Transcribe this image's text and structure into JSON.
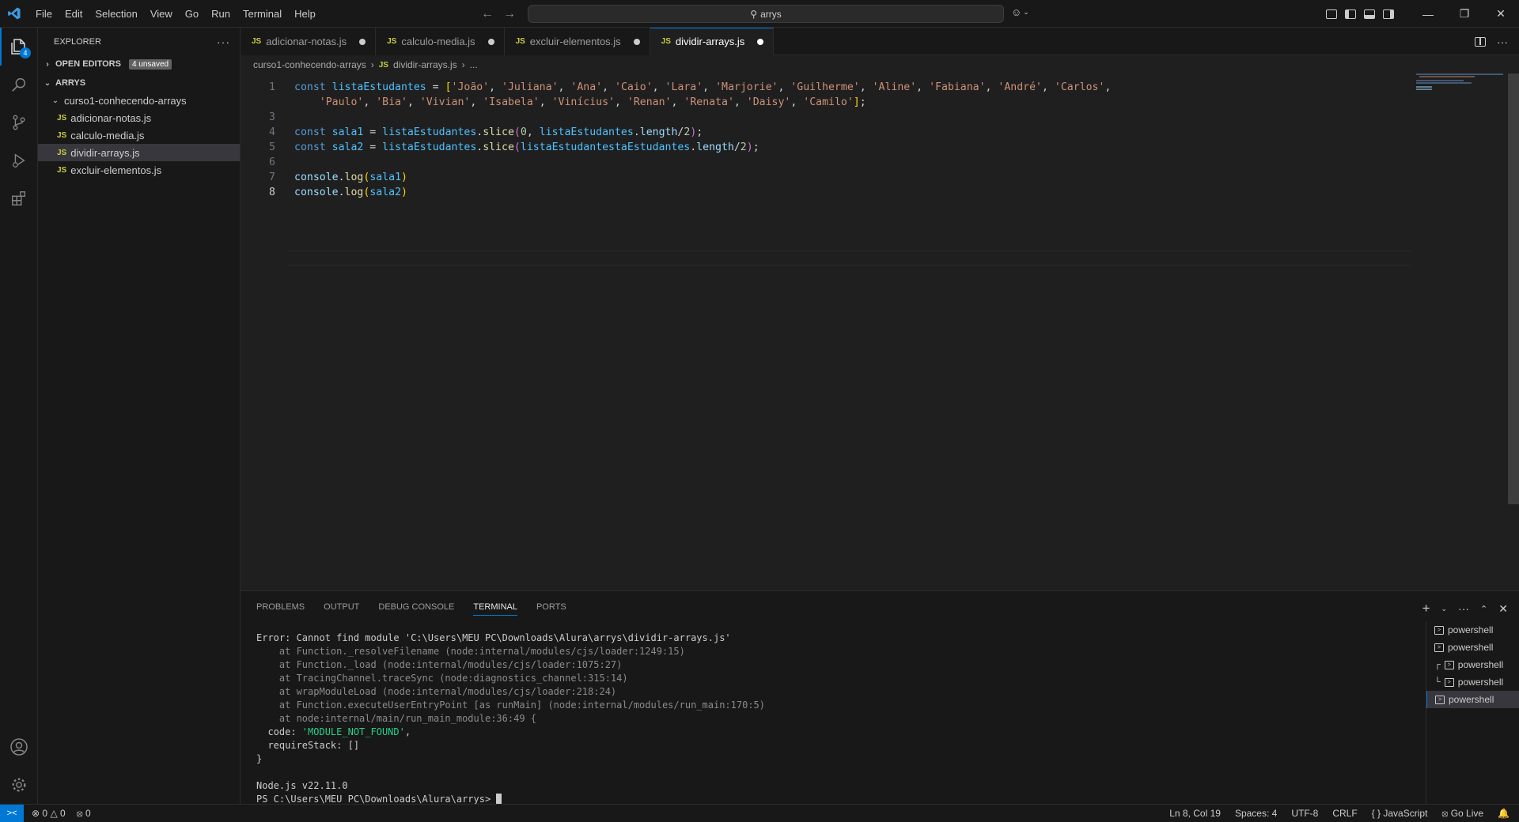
{
  "menu": [
    "File",
    "Edit",
    "Selection",
    "View",
    "Go",
    "Run",
    "Terminal",
    "Help"
  ],
  "search": {
    "text": "arrys"
  },
  "sidebar": {
    "title": "EXPLORER",
    "open_editors_label": "OPEN EDITORS",
    "unsaved_badge": "4 unsaved",
    "root_label": "ARRYS",
    "folder": "curso1-conhecendo-arrays",
    "files": [
      {
        "name": "adicionar-notas.js",
        "selected": false
      },
      {
        "name": "calculo-media.js",
        "selected": false
      },
      {
        "name": "dividir-arrays.js",
        "selected": true
      },
      {
        "name": "excluir-elementos.js",
        "selected": false
      }
    ]
  },
  "activity_badge": "4",
  "tabs": [
    {
      "label": "adicionar-notas.js",
      "active": false
    },
    {
      "label": "calculo-media.js",
      "active": false
    },
    {
      "label": "excluir-elementos.js",
      "active": false
    },
    {
      "label": "dividir-arrays.js",
      "active": true
    }
  ],
  "breadcrumb": {
    "folder": "curso1-conhecendo-arrays",
    "file": "dividir-arrays.js",
    "more": "..."
  },
  "editor": {
    "line_numbers": [
      "1",
      "",
      "3",
      "4",
      "5",
      "6",
      "7",
      "8"
    ],
    "names": [
      "João",
      "Juliana",
      "Ana",
      "Caio",
      "Lara",
      "Marjorie",
      "Guilherme",
      "Aline",
      "Fabiana",
      "André",
      "Carlos",
      "Paulo",
      "Bia",
      "Vivian",
      "Isabela",
      "Vinícius",
      "Renan",
      "Renata",
      "Daisy",
      "Camilo"
    ],
    "ident_lista": "listaEstudantes",
    "ident_sala1": "sala1",
    "ident_sala2": "sala2",
    "ident_broken": "listaEstudantestaEstudantes",
    "kw_const": "const",
    "fn_slice": "slice",
    "prop_length": "length",
    "num_0": "0",
    "num_2": "2",
    "console": "console",
    "fn_log": "log"
  },
  "panel": {
    "tabs": [
      "PROBLEMS",
      "OUTPUT",
      "DEBUG CONSOLE",
      "TERMINAL",
      "PORTS"
    ],
    "active_tab": "TERMINAL",
    "terminal_lines": [
      {
        "text": "Error: Cannot find module 'C:\\Users\\MEU PC\\Downloads\\Alura\\arrys\\dividir-arrays.js'",
        "style": ""
      },
      {
        "text": "    at Function._resolveFilename (node:internal/modules/cjs/loader:1249:15)",
        "style": "gray"
      },
      {
        "text": "    at Function._load (node:internal/modules/cjs/loader:1075:27)",
        "style": "gray"
      },
      {
        "text": "    at TracingChannel.traceSync (node:diagnostics_channel:315:14)",
        "style": "gray"
      },
      {
        "text": "    at wrapModuleLoad (node:internal/modules/cjs/loader:218:24)",
        "style": "gray"
      },
      {
        "text": "    at Function.executeUserEntryPoint [as runMain] (node:internal/modules/run_main:170:5)",
        "style": "gray"
      },
      {
        "text": "    at node:internal/main/run_main_module:36:49 {",
        "style": "gray"
      },
      {
        "text": "  code: ",
        "style": "code"
      },
      {
        "text": "  requireStack: []",
        "style": ""
      },
      {
        "text": "}",
        "style": ""
      },
      {
        "text": "",
        "style": ""
      },
      {
        "text": "Node.js v22.11.0",
        "style": ""
      }
    ],
    "code_value": "'MODULE_NOT_FOUND'",
    "code_suffix": ",",
    "prompt": "PS C:\\Users\\MEU PC\\Downloads\\Alura\\arrys> ",
    "terminals": [
      "powershell",
      "powershell",
      "powershell",
      "powershell",
      "powershell"
    ]
  },
  "status": {
    "errors": "0",
    "warnings": "0",
    "ports": "0",
    "position": "Ln 8, Col 19",
    "spaces": "Spaces: 4",
    "encoding": "UTF-8",
    "eol": "CRLF",
    "language": "JavaScript",
    "golive": "Go Live"
  },
  "colors": {
    "accent": "#0078d4",
    "js_icon": "#cbcb41",
    "background": "#1f1f1f"
  }
}
